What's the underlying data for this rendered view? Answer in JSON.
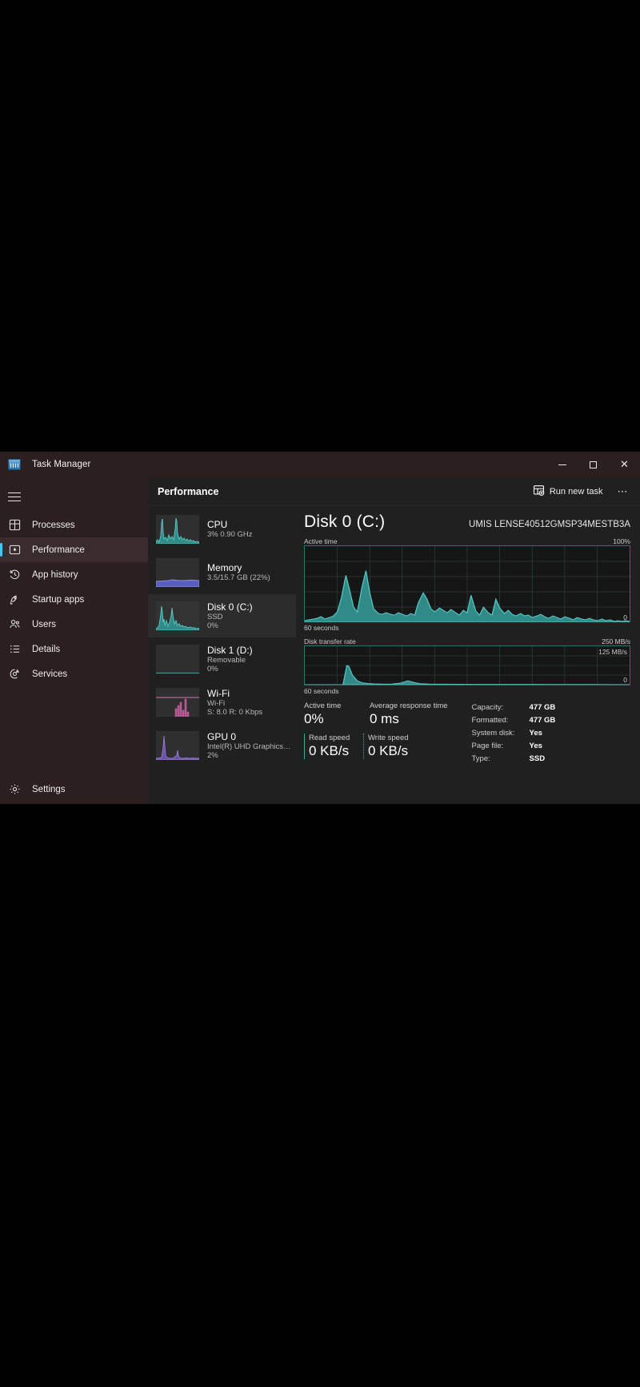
{
  "window": {
    "app_icon": "task-manager-icon",
    "title": "Task Manager",
    "minimize_label": "Minimize",
    "maximize_label": "Maximize",
    "close_label": "Close"
  },
  "sidebar": {
    "hamburger_label": "Navigation",
    "items": [
      {
        "icon": "grid-icon",
        "label": "Processes",
        "active": false
      },
      {
        "icon": "gauge-icon",
        "label": "Performance",
        "active": true
      },
      {
        "icon": "history-icon",
        "label": "App history",
        "active": false
      },
      {
        "icon": "rocket-icon",
        "label": "Startup apps",
        "active": false
      },
      {
        "icon": "users-icon",
        "label": "Users",
        "active": false
      },
      {
        "icon": "list-icon",
        "label": "Details",
        "active": false
      },
      {
        "icon": "services-icon",
        "label": "Services",
        "active": false
      }
    ],
    "bottom": [
      {
        "icon": "gear-icon",
        "label": "Settings"
      }
    ]
  },
  "toolbar": {
    "title": "Performance",
    "run_new_task_label": "Run new task",
    "run_new_task_icon": "new-task-icon",
    "more_label": "See more",
    "more_icon": "ellipsis-icon"
  },
  "performance_list": [
    {
      "name": "CPU",
      "sub1": "3%  0.90 GHz",
      "sub2": "",
      "active": false,
      "color": "#4fc3c7",
      "style": "spiky"
    },
    {
      "name": "Memory",
      "sub1": "3.5/15.7 GB (22%)",
      "sub2": "",
      "active": false,
      "color": "#8b8fe0",
      "style": "low-fill"
    },
    {
      "name": "Disk 0 (C:)",
      "sub1": "SSD",
      "sub2": "0%",
      "active": true,
      "color": "#4fc3c7",
      "style": "spiky"
    },
    {
      "name": "Disk 1 (D:)",
      "sub1": "Removable",
      "sub2": "0%",
      "active": false,
      "color": "#4fc3c7",
      "style": "flat"
    },
    {
      "name": "Wi-Fi",
      "sub1": "Wi-Fi",
      "sub2": "S: 8.0 R: 0 Kbps",
      "active": false,
      "color": "#d96bb4",
      "style": "bars"
    },
    {
      "name": "GPU 0",
      "sub1": "Intel(R) UHD Graphics ...",
      "sub2": "2%",
      "active": false,
      "color": "#9b7bd4",
      "style": "spiky-low"
    }
  ],
  "detail": {
    "title": "Disk 0 (C:)",
    "model": "UMIS LENSE40512GMSP34MESTB3A",
    "active_time_graph": {
      "label": "Active time",
      "max_label": "100%",
      "min_label": "0",
      "time_label": "60 seconds"
    },
    "transfer_rate_graph": {
      "label": "Disk transfer rate",
      "max_label": "250 MB/s",
      "mid_label": "125 MB/s",
      "min_label": "0",
      "time_label": "60 seconds"
    },
    "stats": [
      {
        "caption": "Active time",
        "value": "0%"
      },
      {
        "caption": "Average response time",
        "value": "0 ms"
      }
    ],
    "speed_stats": [
      {
        "caption": "Read speed",
        "value": "0 KB/s",
        "accent": "#3fa7a0",
        "border": "solid"
      },
      {
        "caption": "Write speed",
        "value": "0 KB/s",
        "accent": "#3fa7a0",
        "border": "dotted"
      }
    ],
    "properties": [
      {
        "key": "Capacity:",
        "value": "477 GB"
      },
      {
        "key": "Formatted:",
        "value": "477 GB"
      },
      {
        "key": "System disk:",
        "value": "Yes"
      },
      {
        "key": "Page file:",
        "value": "Yes"
      },
      {
        "key": "Type:",
        "value": "SSD"
      }
    ]
  },
  "colors": {
    "accent": "#4cc2ff",
    "disk_line": "#57c4c0",
    "disk_fill": "#2f8a88",
    "titlebar": "#2b1f1f",
    "content_bg": "#202020"
  },
  "chart_data": [
    {
      "type": "area",
      "title": "Active time",
      "ylabel": "",
      "xlabel": "60 seconds",
      "ylim": [
        0,
        100
      ],
      "ytick_labels": [
        "100%",
        "0"
      ],
      "grid": true,
      "series": [
        {
          "name": "Active time",
          "values": [
            2,
            3,
            2,
            4,
            3,
            5,
            4,
            3,
            6,
            4,
            3,
            5,
            8,
            30,
            62,
            40,
            20,
            14,
            52,
            68,
            44,
            22,
            12,
            10,
            14,
            12,
            10,
            16,
            12,
            9,
            14,
            11,
            26,
            38,
            30,
            18,
            14,
            22,
            17,
            13,
            18,
            12,
            9,
            15,
            12,
            33,
            18,
            12,
            20,
            14,
            10,
            30,
            19,
            12,
            16,
            11,
            9,
            14,
            10,
            12,
            9,
            8,
            10,
            7,
            9,
            11,
            8,
            6,
            9,
            7,
            6,
            8,
            5,
            7,
            6,
            5,
            4,
            6,
            4,
            3
          ]
        }
      ]
    },
    {
      "type": "area",
      "title": "Disk transfer rate",
      "ylabel": "",
      "xlabel": "60 seconds",
      "ylim": [
        0,
        250
      ],
      "ytick_labels": [
        "250 MB/s",
        "125 MB/s",
        "0"
      ],
      "grid": true,
      "series": [
        {
          "name": "Disk transfer rate",
          "values": [
            0,
            0,
            0,
            0,
            0,
            0,
            0,
            0,
            0,
            0,
            0,
            125,
            118,
            60,
            22,
            12,
            8,
            6,
            5,
            4,
            4,
            3,
            3,
            2,
            2,
            2,
            2,
            2,
            2,
            2,
            3,
            6,
            10,
            14,
            12,
            8,
            5,
            4,
            3,
            3,
            3,
            2,
            2,
            2,
            2,
            2,
            2,
            2,
            2,
            2,
            2,
            2,
            2,
            2,
            2,
            1,
            1,
            1,
            1,
            1,
            1,
            1,
            1,
            1,
            1,
            1,
            1,
            1,
            1,
            1,
            1,
            1,
            1,
            1,
            1,
            1,
            1,
            1,
            1,
            1
          ]
        }
      ]
    }
  ]
}
